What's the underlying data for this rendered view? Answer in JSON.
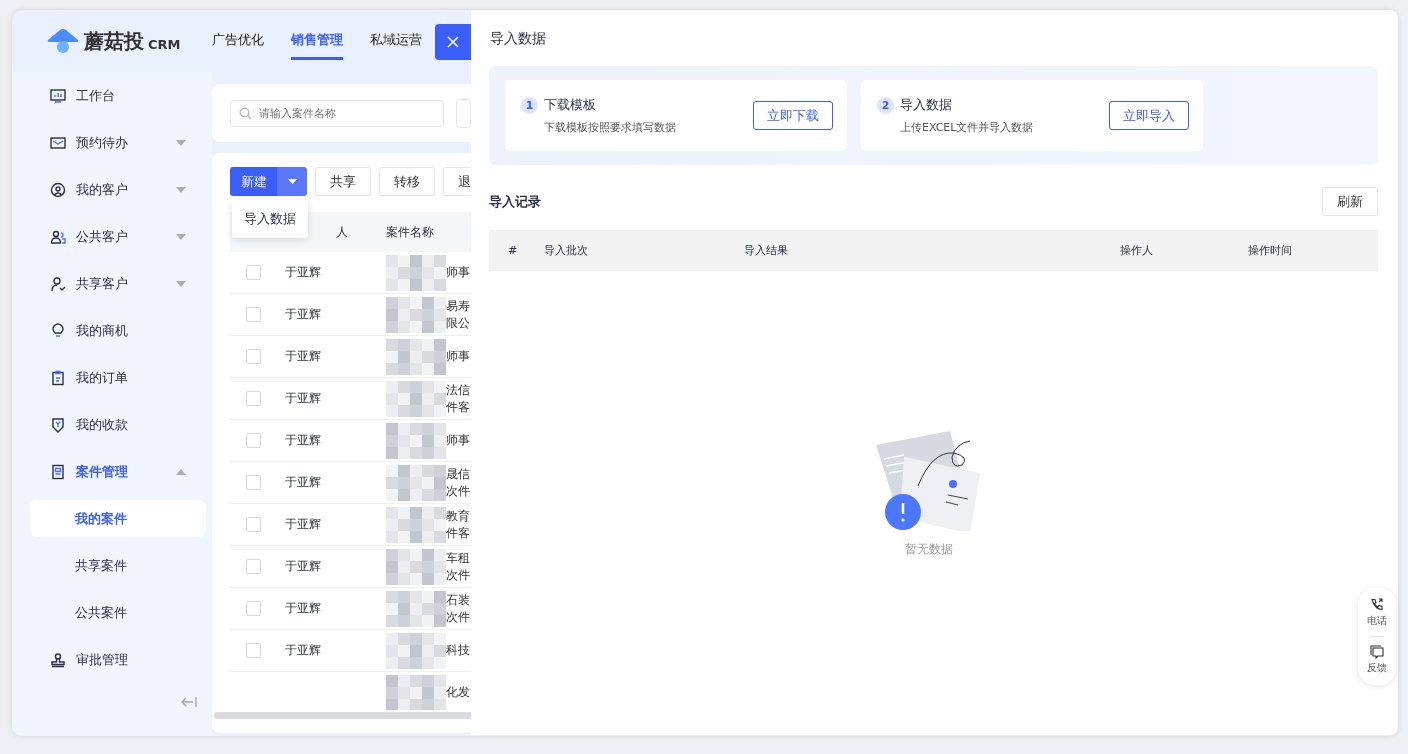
{
  "logo": {
    "name": "蘑菇投",
    "suffix": "CRM"
  },
  "nav": [
    {
      "label": "广告优化",
      "selected": false
    },
    {
      "label": "销售管理",
      "selected": true
    },
    {
      "label": "私域运营",
      "selected": false
    }
  ],
  "sidebar": {
    "items": [
      {
        "label": "工作台",
        "selected": false
      },
      {
        "label": "预约待办",
        "expanded": false,
        "selected": false
      },
      {
        "label": "我的客户",
        "expanded": false,
        "selected": false
      },
      {
        "label": "公共客户",
        "expanded": false,
        "selected": false
      },
      {
        "label": "共享客户",
        "expanded": false,
        "selected": false
      },
      {
        "label": "我的商机",
        "selected": false
      },
      {
        "label": "我的订单",
        "selected": false
      },
      {
        "label": "我的收款",
        "selected": false
      },
      {
        "label": "案件管理",
        "expanded": true,
        "selected": true,
        "children": [
          {
            "label": "我的案件",
            "selected": true
          },
          {
            "label": "共享案件",
            "selected": false
          },
          {
            "label": "公共案件",
            "selected": false
          }
        ]
      },
      {
        "label": "审批管理",
        "selected": false
      }
    ]
  },
  "search": {
    "placeholder": "请输入案件名称"
  },
  "toolbar": {
    "new_button": "新建",
    "dropdown_item": "导入数据",
    "buttons": [
      "共享",
      "转移",
      "退"
    ]
  },
  "table": {
    "columns": [
      "人",
      "案件名称"
    ],
    "rows": [
      {
        "checked": false,
        "owner": "于亚辉",
        "case_name": [
          "师事"
        ]
      },
      {
        "checked": false,
        "owner": "于亚辉",
        "case_name": [
          "易寿",
          "限公"
        ]
      },
      {
        "checked": false,
        "owner": "于亚辉",
        "case_name": [
          "师事"
        ]
      },
      {
        "checked": false,
        "owner": "于亚辉",
        "case_name": [
          "法信",
          "件客"
        ]
      },
      {
        "checked": false,
        "owner": "于亚辉",
        "case_name": [
          "师事"
        ]
      },
      {
        "checked": false,
        "owner": "于亚辉",
        "case_name": [
          "晟信",
          "次件"
        ]
      },
      {
        "checked": false,
        "owner": "于亚辉",
        "case_name": [
          "教育",
          "件客"
        ]
      },
      {
        "checked": false,
        "owner": "于亚辉",
        "case_name": [
          "车租",
          "次件"
        ]
      },
      {
        "checked": false,
        "owner": "于亚辉",
        "case_name": [
          "石装",
          "次件"
        ]
      },
      {
        "checked": false,
        "owner": "于亚辉",
        "case_name": [
          "科技"
        ]
      },
      {
        "case_name": [
          "化发"
        ]
      }
    ]
  },
  "drawer": {
    "title": "导入数据",
    "steps": [
      {
        "number": "1",
        "title": "下载模板",
        "description": "下载模板按照要求填写数据",
        "button": "立即下载"
      },
      {
        "number": "2",
        "title": "导入数据",
        "description": "上传EXCEL文件并导入数据",
        "button": "立即导入"
      }
    ],
    "records_title": "导入记录",
    "refresh_button": "刷新",
    "columns": [
      "#",
      "导入批次",
      "导入结果",
      "操作人",
      "操作时间"
    ],
    "empty_text": "暂无数据"
  },
  "float_tools": [
    {
      "label": "电话"
    },
    {
      "label": "反馈"
    }
  ]
}
